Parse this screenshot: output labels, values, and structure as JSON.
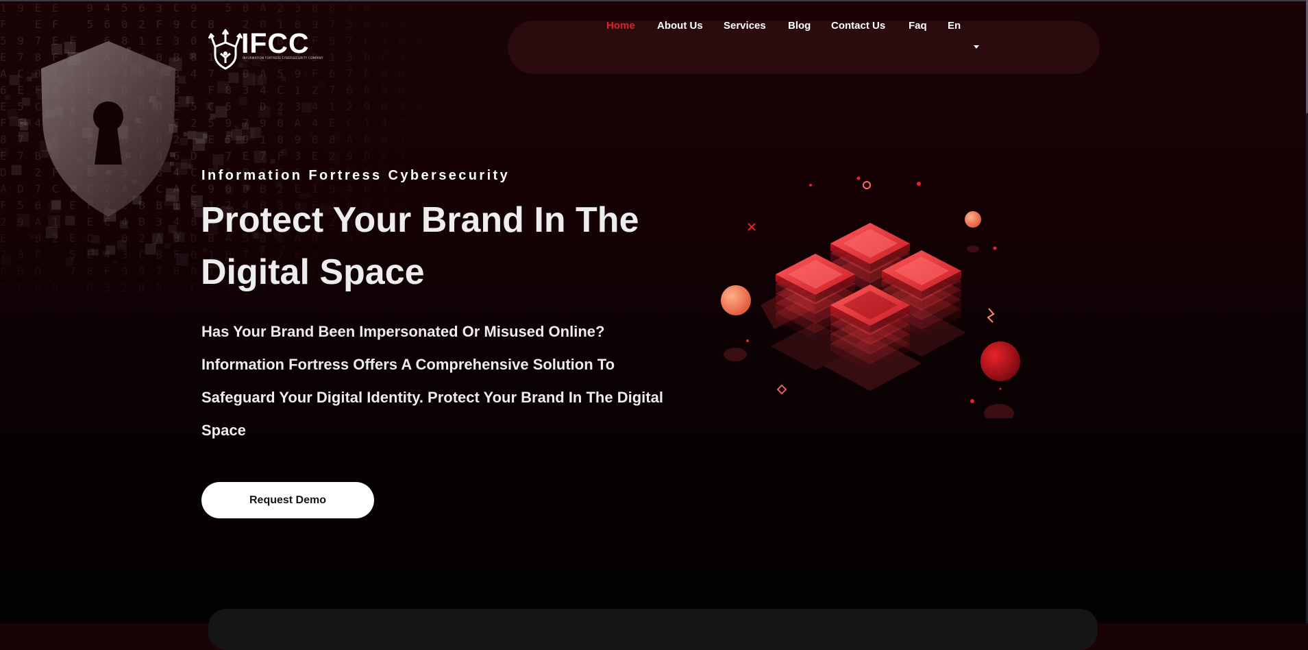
{
  "brand": {
    "logo_text": "IFCC",
    "logo_tagline": "INFORMATION FORTRESS CYBERSECURITY COMPANY",
    "logo_icon": "fortress-network-icon"
  },
  "nav": {
    "items": [
      {
        "label": "Home",
        "active": true
      },
      {
        "label": "About Us",
        "active": false
      },
      {
        "label": "Services",
        "active": false
      },
      {
        "label": "Blog",
        "active": false
      },
      {
        "label": "Contact Us",
        "active": false
      },
      {
        "label": "Faq",
        "active": false
      }
    ],
    "language": {
      "label": "En",
      "icon": "caret-down-icon"
    }
  },
  "hero": {
    "kicker": "Information Fortress Cybersecurity",
    "title": "Protect Your Brand In The Digital Space",
    "description": "Has Your Brand Been Impersonated Or Misused Online? Information Fortress Offers A Comprehensive Solution To Safeguard Your Digital Identity. Protect Your Brand In The Digital Space",
    "cta_label": "Request Demo"
  },
  "decor": {
    "background_icon": "shield-keyhole-icon",
    "illustration": "isometric-server-stack-illustration",
    "digit_stream": [
      "1 9 E E   9 4 5 6 3 C 9   5 8 A 2 3 8 8 4 8 2 F",
      "F   E F   5 6 0 2 F 9 C B   2 0 1 8 9 7 5 0 D 3",
      "5 9 7 E F   6 8 1 E 3 0 4   8 7 B 7 F 9 7 C 2 8 8",
      "E 7 8 F 6   A B C 0 B 8 1   C 2 9 4 D 1 3 0 F 9",
      "A C 0 1 A F C 4 8 2 3 4 7   0 A 5 9 F 6 7 E 8 B",
      "6 E F 0 5 E 6 B   E B   F 8 3 4 C 1 2 7 6 A 5 D",
      "E 5 C   7 E F 6 8 D E 5 C 5   D 2 3 4 1 2 9 0 3 8",
      "F E 4   8 5   C B   E 2 5 9 7 9 0 A 4 E C 1 4 2",
      "8 7   F   E C B 7 6 2   E 5 9 1 8 9 0 8 A 6 6 3",
      "E 7 B D   F 7 8 F 9 6 D   7 E 7 F 3 E 2 9 D 5 3",
      "D   2 F   E   3 C 8 4 C D 1 B 9 C C 0 5 E 8 1 D",
      "A D 7 C   C 7 A 3 C A C 9 0 D B 2 E 1 9 4 6 3 F",
      "F 5 6   E F 2 C B B 1 5 1 2 4 B 3 0 F 3 4 2 7 D",
      "2 9 A 1   E C 4 B 3 4 8 A 5 0 4 2 1 C 2 0 4 1 2",
      "E   B 2 E C   0 2 A B D B A 5 B 2 A B   9 F 1 7",
      "7 8 F   5 E 4 3 C B F 0 1 B 7 F 2 E 8 6 D 2 F 9",
      "6 B D   7 8 F 9 9 7 8 0 1 8 9   7   F   F   D 5",
      "7 E 0 8   D 3 2 B 5   C 4 3 8 7 6 1 E 2 9 A 0 C"
    ]
  },
  "colors": {
    "accent": "#d8262c",
    "nav_bg": "#2a0c0e",
    "page_top": "#1a0305",
    "page_bottom": "#030101",
    "button_bg": "#ffffff",
    "button_text": "#141414"
  }
}
